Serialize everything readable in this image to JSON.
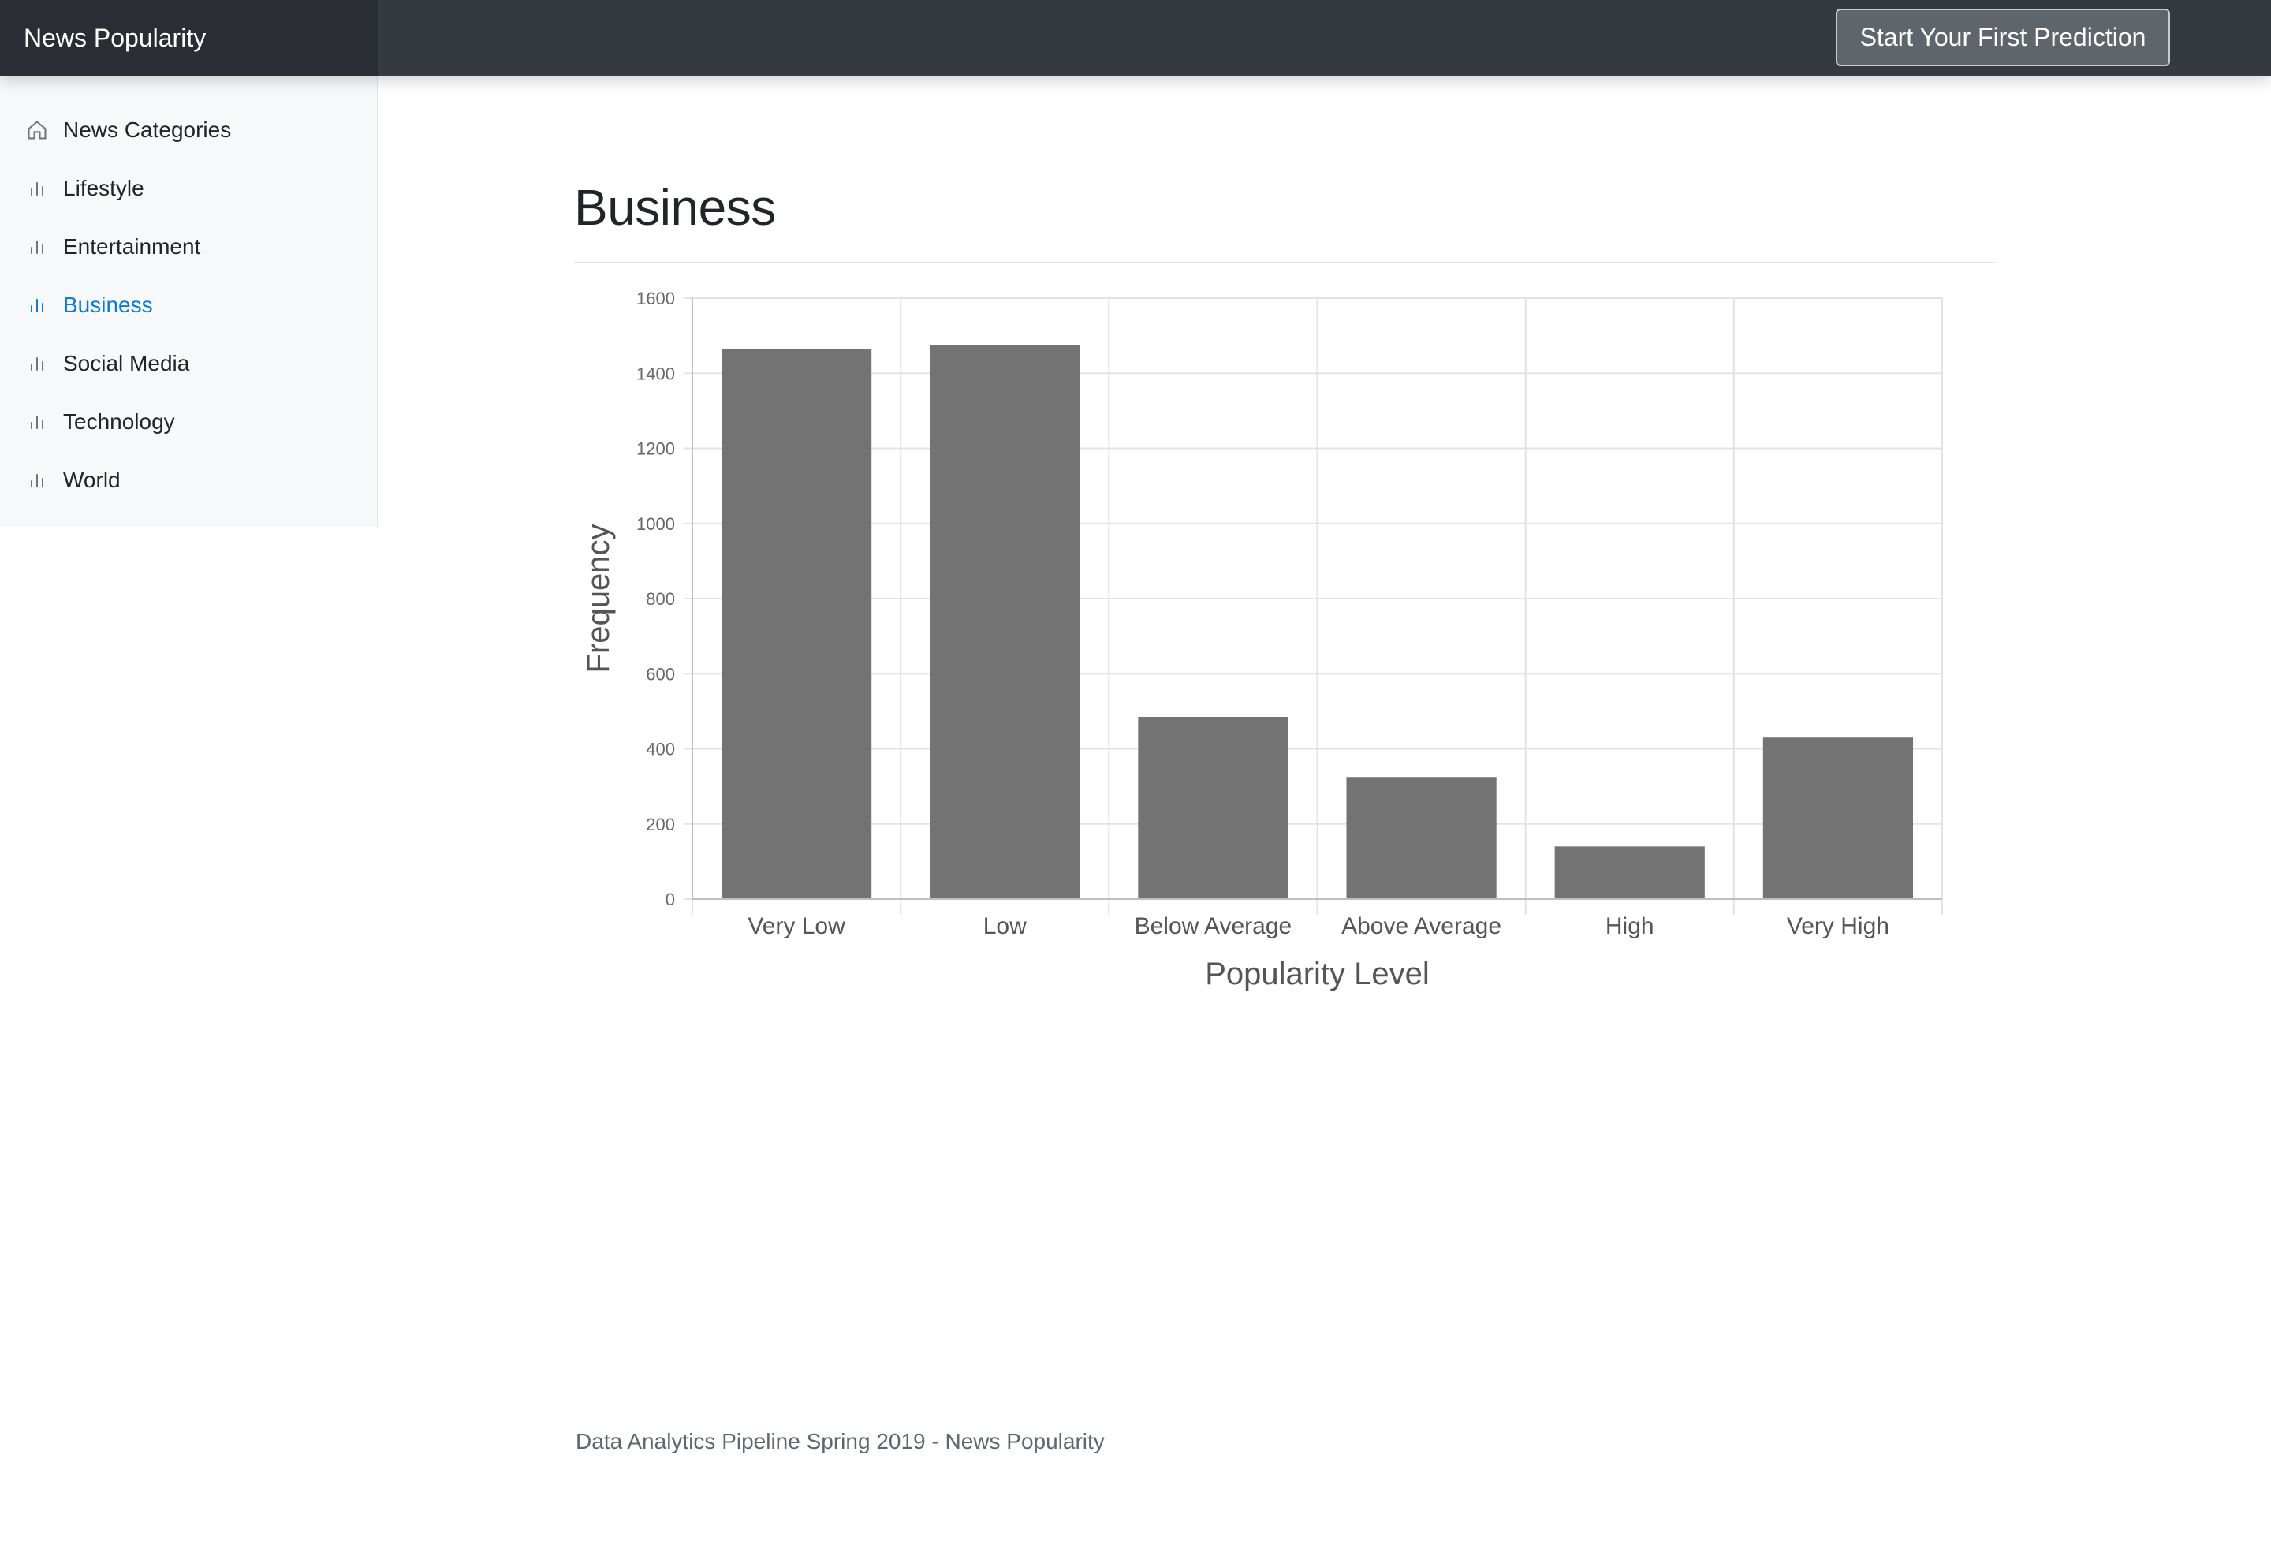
{
  "navbar": {
    "brand": "News Popularity",
    "cta_label": "Start Your First Prediction"
  },
  "sidebar": {
    "items": [
      {
        "label": "News Categories",
        "icon": "home-icon",
        "active": false
      },
      {
        "label": "Lifestyle",
        "icon": "bar-chart-icon",
        "active": false
      },
      {
        "label": "Entertainment",
        "icon": "bar-chart-icon",
        "active": false
      },
      {
        "label": "Business",
        "icon": "bar-chart-icon",
        "active": true
      },
      {
        "label": "Social Media",
        "icon": "bar-chart-icon",
        "active": false
      },
      {
        "label": "Technology",
        "icon": "bar-chart-icon",
        "active": false
      },
      {
        "label": "World",
        "icon": "bar-chart-icon",
        "active": false
      }
    ]
  },
  "main": {
    "title": "Business"
  },
  "chart_data": {
    "type": "bar",
    "categories": [
      "Very Low",
      "Low",
      "Below Average",
      "Above Average",
      "High",
      "Very High"
    ],
    "values": [
      1465,
      1475,
      485,
      325,
      140,
      430
    ],
    "xlabel": "Popularity Level",
    "ylabel": "Frequency",
    "ylim": [
      0,
      1600
    ],
    "yticks": [
      0,
      200,
      400,
      600,
      800,
      1000,
      1200,
      1400,
      1600
    ],
    "grid": true,
    "bar_color": "#737373"
  },
  "footer": {
    "text": "Data Analytics Pipeline Spring 2019 - News Popularity"
  },
  "colors": {
    "navbar": "#343a40",
    "brand_bg": "#2a2d31",
    "active_link": "#0a7bd6",
    "sidebar_bg": "#f7f8f9"
  }
}
